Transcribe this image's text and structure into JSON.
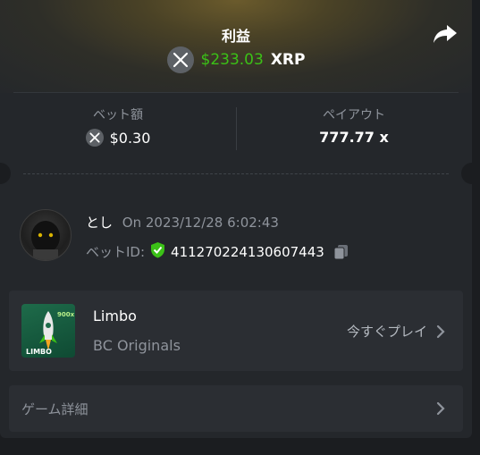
{
  "header": {
    "title": "利益",
    "profit_amount": "$233.03",
    "profit_currency": "XRP"
  },
  "stats": {
    "bet_label": "ベット額",
    "bet_value": "$0.30",
    "payout_label": "ペイアウト",
    "payout_value": "777.77 x"
  },
  "user": {
    "name": "とし",
    "datetime": "On 2023/12/28 6:02:43",
    "bet_id_label": "ベットID:",
    "bet_id_value": "411270224130607443"
  },
  "game": {
    "name": "Limbo",
    "provider": "BC Originals",
    "play_label": "今すぐプレイ",
    "thumb_text": "LIMBO",
    "thumb_badge": "900x"
  },
  "details": {
    "label": "ゲーム詳細"
  },
  "colors": {
    "profit_green": "#3bc117",
    "panel_bg": "#24272b",
    "card_bg": "#2b2e33",
    "muted_text": "#8f949c"
  },
  "icons": [
    "share-icon",
    "xrp-coin-icon",
    "shield-check-icon",
    "copy-icon",
    "chevron-right-icon"
  ]
}
